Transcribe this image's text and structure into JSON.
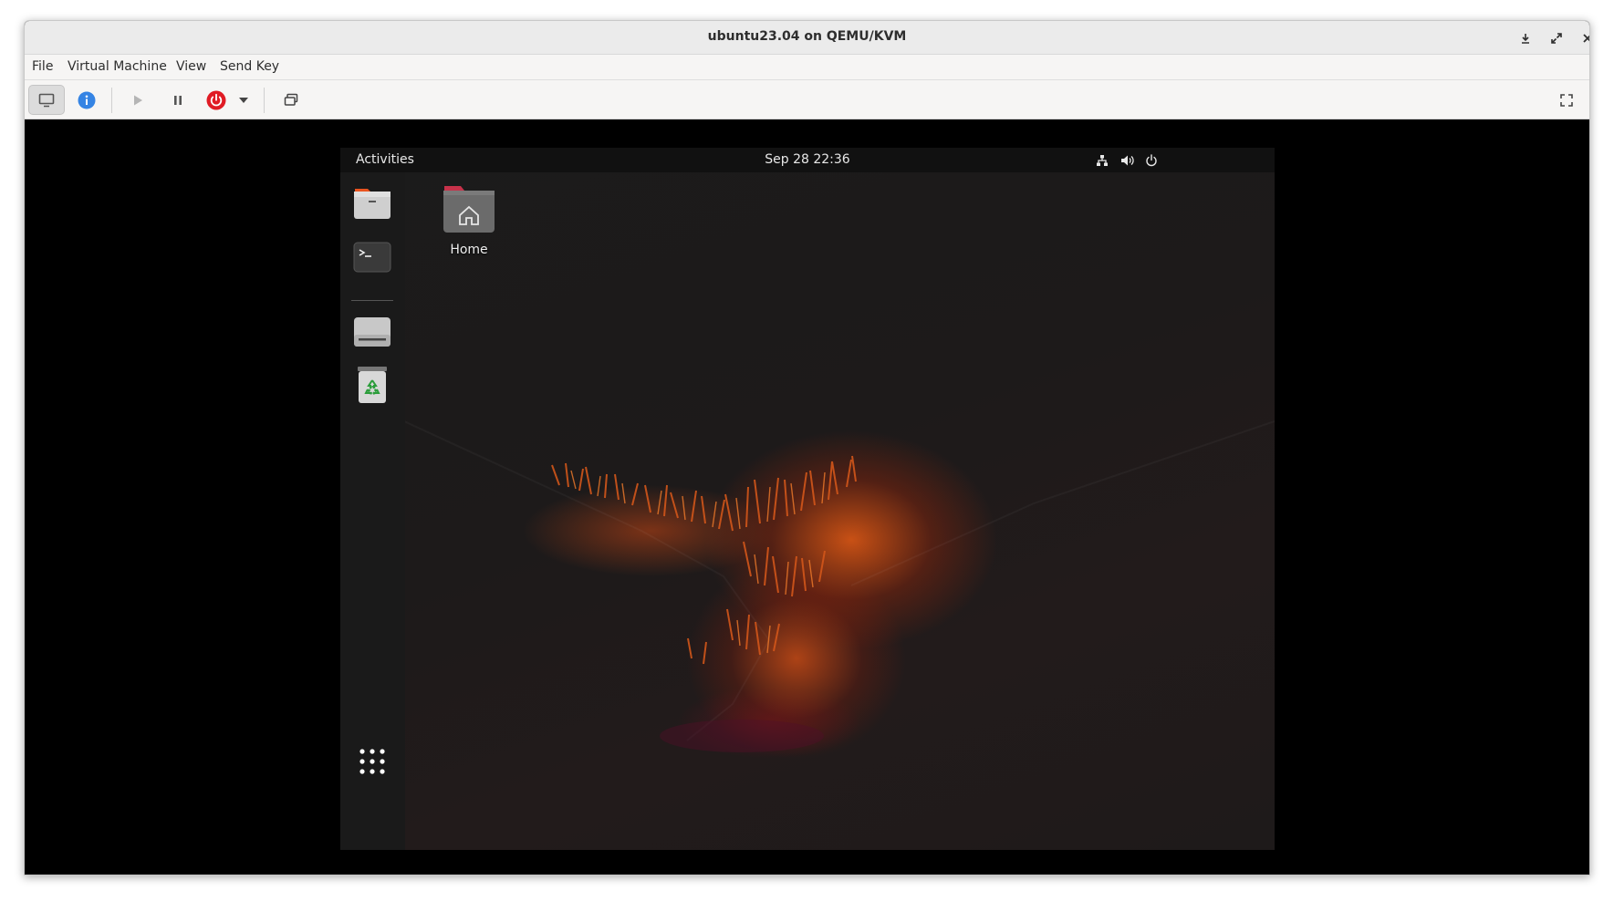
{
  "window": {
    "title": "ubuntu23.04 on QEMU/KVM"
  },
  "menubar": {
    "items": [
      "File",
      "Virtual Machine",
      "View",
      "Send Key"
    ]
  },
  "toolbar": {
    "buttons": [
      "console-icon",
      "info-icon",
      "play-icon",
      "pause-icon",
      "power-icon",
      "dropdown-icon",
      "snapshot-icon",
      "fullscreen-icon"
    ]
  },
  "guest": {
    "topbar": {
      "activities": "Activities",
      "clock": "Sep 28  22:36"
    },
    "dock": {
      "items": [
        "files-icon",
        "terminal-icon",
        "drive-icon",
        "trash-icon",
        "app-grid-icon"
      ]
    },
    "desktop": {
      "home_label": "Home"
    }
  },
  "colors": {
    "power_red": "#e01b24",
    "info_blue": "#3584e4",
    "folder_accent": "#e95420"
  }
}
